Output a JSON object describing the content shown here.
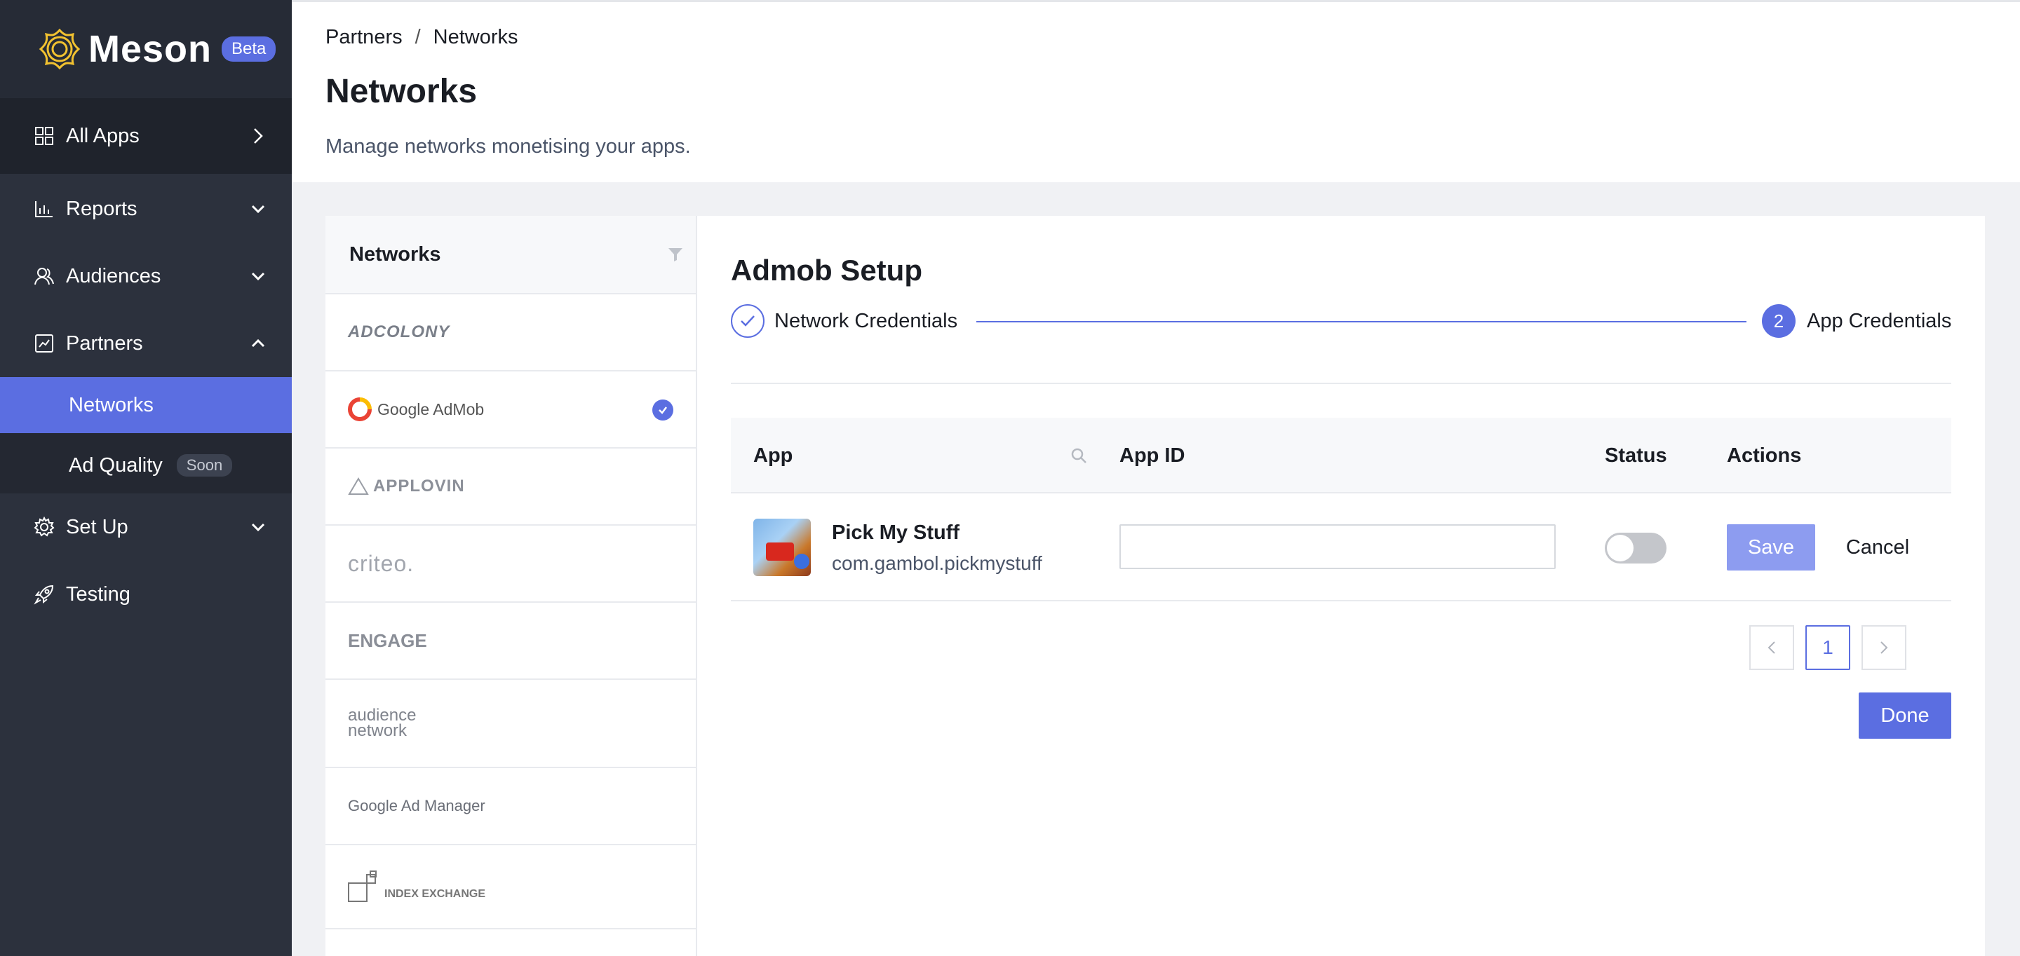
{
  "brand": {
    "name": "Meson",
    "badge": "Beta"
  },
  "sidebar": {
    "items": [
      {
        "label": "All Apps",
        "icon": "grid-icon"
      },
      {
        "label": "Reports",
        "icon": "bar-chart-icon"
      },
      {
        "label": "Audiences",
        "icon": "users-icon"
      },
      {
        "label": "Partners",
        "icon": "partners-icon"
      },
      {
        "label": "Set Up",
        "icon": "gear-icon"
      },
      {
        "label": "Testing",
        "icon": "rocket-icon"
      }
    ],
    "partners_sub": [
      {
        "label": "Networks",
        "active": true
      },
      {
        "label": "Ad Quality",
        "badge": "Soon"
      }
    ]
  },
  "header": {
    "breadcrumb": [
      "Partners",
      "Networks"
    ],
    "title": "Networks",
    "subtitle": "Manage networks monetising your apps."
  },
  "networks": {
    "heading": "Networks",
    "items": [
      {
        "label": "ADCOLONY"
      },
      {
        "label": "Google AdMob",
        "selected": true
      },
      {
        "label": "APPLOVIN"
      },
      {
        "label": "criteo."
      },
      {
        "label": "ENGAGE"
      },
      {
        "label": "audience network"
      },
      {
        "label": "Google Ad Manager"
      },
      {
        "label": "INDEX EXCHANGE"
      }
    ]
  },
  "setup": {
    "title": "Admob Setup",
    "steps": [
      {
        "label": "Network Credentials",
        "state": "done"
      },
      {
        "number": "2",
        "label": "App Credentials",
        "state": "active"
      }
    ],
    "table": {
      "columns": [
        "App",
        "App ID",
        "Status",
        "Actions"
      ],
      "rows": [
        {
          "name": "Pick My Stuff",
          "bundle": "com.gambol.pickmystuff",
          "app_id": "",
          "status_on": false,
          "save_label": "Save",
          "cancel_label": "Cancel"
        }
      ]
    },
    "pagination": {
      "prev": "<",
      "page": "1",
      "next": ">"
    },
    "done_label": "Done"
  },
  "colors": {
    "accent": "#5b6ee1",
    "sidebar": "#2c313d"
  }
}
